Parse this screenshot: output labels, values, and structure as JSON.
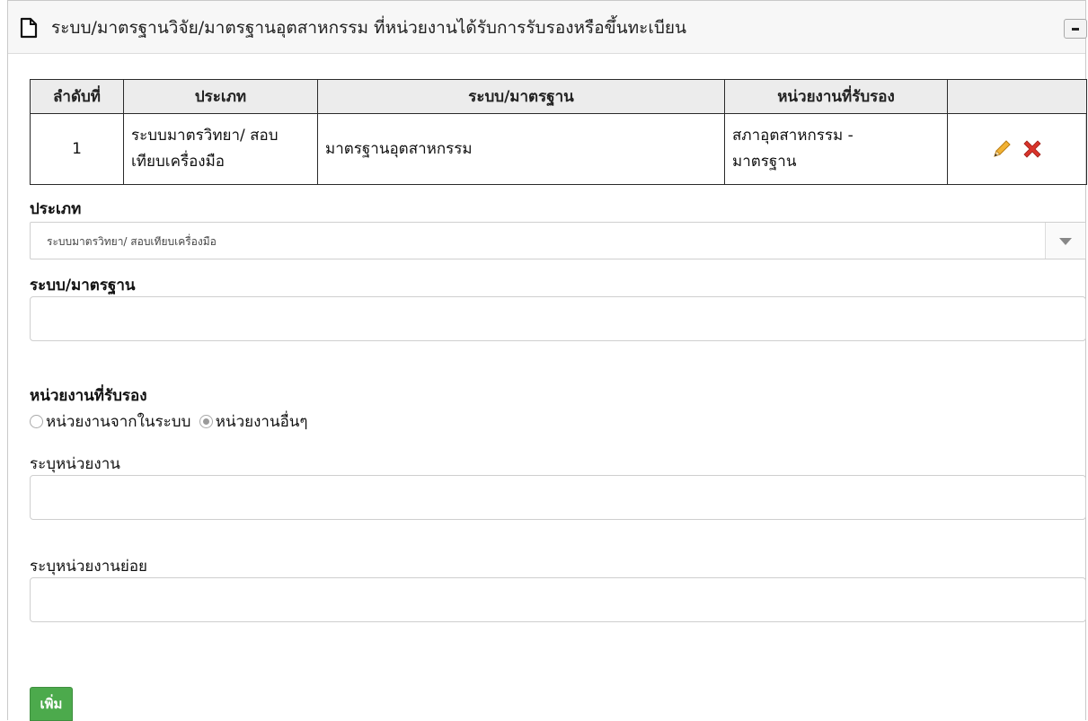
{
  "panel": {
    "title": "ระบบ/มาตรฐานวิจัย/มาตรฐานอุตสาหกรรม ที่หน่วยงานได้รับการรับรองหรือขึ้นทะเบียน",
    "icon": "document-icon",
    "collapse_icon": "minus-icon"
  },
  "table": {
    "headers": [
      "ลำดับที่",
      "ประเภท",
      "ระบบ/มาตรฐาน",
      "หน่วยงานที่รับรอง",
      ""
    ],
    "rows": [
      {
        "no": "1",
        "type_line1": "ระบบมาตรวิทยา/ สอบ",
        "type_line2": "เทียบเครื่องมือ",
        "standard": "มาตรฐานอุตสาหกรรม",
        "org_line1": "สภาอุตสาหกรรม -",
        "org_line2": "มาตรฐาน",
        "actions": [
          "pencil-icon",
          "delete-x-icon"
        ]
      }
    ]
  },
  "form": {
    "type_label": "ประเภท",
    "type_selected": "ระบบมาตรวิทยา/ สอบเทียบเครื่องมือ",
    "standard_label": "ระบบ/มาตรฐาน",
    "standard_value": "",
    "certifier_label": "หน่วยงานที่รับรอง",
    "radio_options": [
      {
        "label": "หน่วยงานจากในระบบ",
        "checked": false
      },
      {
        "label": "หน่วยงานอื่นๆ",
        "checked": true
      }
    ],
    "org_label": "ระบุหน่วยงาน",
    "org_value": "",
    "suborg_label": "ระบุหน่วยงานย่อย",
    "suborg_value": "",
    "add_button": "เพิ่ม"
  },
  "colors": {
    "add_button": "#4caa4c",
    "delete_icon": "#d9342b",
    "edit_icon": "#e8a317"
  }
}
